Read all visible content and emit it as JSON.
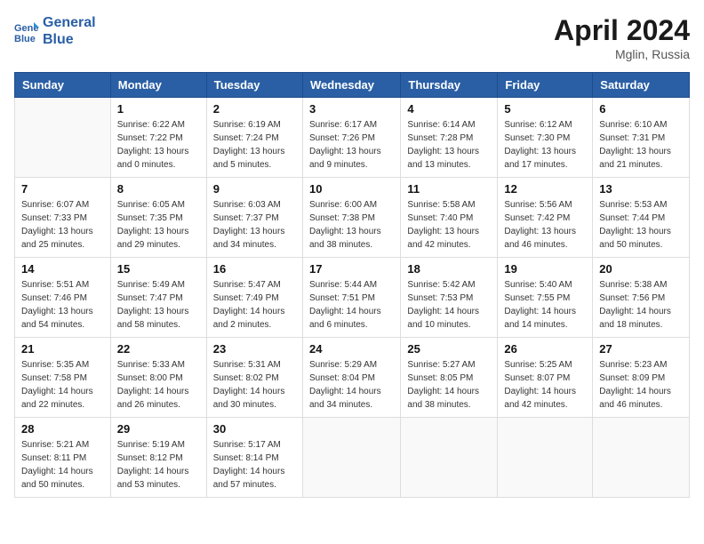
{
  "header": {
    "logo_line1": "General",
    "logo_line2": "Blue",
    "month": "April 2024",
    "location": "Mglin, Russia"
  },
  "days_of_week": [
    "Sunday",
    "Monday",
    "Tuesday",
    "Wednesday",
    "Thursday",
    "Friday",
    "Saturday"
  ],
  "weeks": [
    [
      {
        "day": "",
        "info": ""
      },
      {
        "day": "1",
        "info": "Sunrise: 6:22 AM\nSunset: 7:22 PM\nDaylight: 13 hours\nand 0 minutes."
      },
      {
        "day": "2",
        "info": "Sunrise: 6:19 AM\nSunset: 7:24 PM\nDaylight: 13 hours\nand 5 minutes."
      },
      {
        "day": "3",
        "info": "Sunrise: 6:17 AM\nSunset: 7:26 PM\nDaylight: 13 hours\nand 9 minutes."
      },
      {
        "day": "4",
        "info": "Sunrise: 6:14 AM\nSunset: 7:28 PM\nDaylight: 13 hours\nand 13 minutes."
      },
      {
        "day": "5",
        "info": "Sunrise: 6:12 AM\nSunset: 7:30 PM\nDaylight: 13 hours\nand 17 minutes."
      },
      {
        "day": "6",
        "info": "Sunrise: 6:10 AM\nSunset: 7:31 PM\nDaylight: 13 hours\nand 21 minutes."
      }
    ],
    [
      {
        "day": "7",
        "info": "Sunrise: 6:07 AM\nSunset: 7:33 PM\nDaylight: 13 hours\nand 25 minutes."
      },
      {
        "day": "8",
        "info": "Sunrise: 6:05 AM\nSunset: 7:35 PM\nDaylight: 13 hours\nand 29 minutes."
      },
      {
        "day": "9",
        "info": "Sunrise: 6:03 AM\nSunset: 7:37 PM\nDaylight: 13 hours\nand 34 minutes."
      },
      {
        "day": "10",
        "info": "Sunrise: 6:00 AM\nSunset: 7:38 PM\nDaylight: 13 hours\nand 38 minutes."
      },
      {
        "day": "11",
        "info": "Sunrise: 5:58 AM\nSunset: 7:40 PM\nDaylight: 13 hours\nand 42 minutes."
      },
      {
        "day": "12",
        "info": "Sunrise: 5:56 AM\nSunset: 7:42 PM\nDaylight: 13 hours\nand 46 minutes."
      },
      {
        "day": "13",
        "info": "Sunrise: 5:53 AM\nSunset: 7:44 PM\nDaylight: 13 hours\nand 50 minutes."
      }
    ],
    [
      {
        "day": "14",
        "info": "Sunrise: 5:51 AM\nSunset: 7:46 PM\nDaylight: 13 hours\nand 54 minutes."
      },
      {
        "day": "15",
        "info": "Sunrise: 5:49 AM\nSunset: 7:47 PM\nDaylight: 13 hours\nand 58 minutes."
      },
      {
        "day": "16",
        "info": "Sunrise: 5:47 AM\nSunset: 7:49 PM\nDaylight: 14 hours\nand 2 minutes."
      },
      {
        "day": "17",
        "info": "Sunrise: 5:44 AM\nSunset: 7:51 PM\nDaylight: 14 hours\nand 6 minutes."
      },
      {
        "day": "18",
        "info": "Sunrise: 5:42 AM\nSunset: 7:53 PM\nDaylight: 14 hours\nand 10 minutes."
      },
      {
        "day": "19",
        "info": "Sunrise: 5:40 AM\nSunset: 7:55 PM\nDaylight: 14 hours\nand 14 minutes."
      },
      {
        "day": "20",
        "info": "Sunrise: 5:38 AM\nSunset: 7:56 PM\nDaylight: 14 hours\nand 18 minutes."
      }
    ],
    [
      {
        "day": "21",
        "info": "Sunrise: 5:35 AM\nSunset: 7:58 PM\nDaylight: 14 hours\nand 22 minutes."
      },
      {
        "day": "22",
        "info": "Sunrise: 5:33 AM\nSunset: 8:00 PM\nDaylight: 14 hours\nand 26 minutes."
      },
      {
        "day": "23",
        "info": "Sunrise: 5:31 AM\nSunset: 8:02 PM\nDaylight: 14 hours\nand 30 minutes."
      },
      {
        "day": "24",
        "info": "Sunrise: 5:29 AM\nSunset: 8:04 PM\nDaylight: 14 hours\nand 34 minutes."
      },
      {
        "day": "25",
        "info": "Sunrise: 5:27 AM\nSunset: 8:05 PM\nDaylight: 14 hours\nand 38 minutes."
      },
      {
        "day": "26",
        "info": "Sunrise: 5:25 AM\nSunset: 8:07 PM\nDaylight: 14 hours\nand 42 minutes."
      },
      {
        "day": "27",
        "info": "Sunrise: 5:23 AM\nSunset: 8:09 PM\nDaylight: 14 hours\nand 46 minutes."
      }
    ],
    [
      {
        "day": "28",
        "info": "Sunrise: 5:21 AM\nSunset: 8:11 PM\nDaylight: 14 hours\nand 50 minutes."
      },
      {
        "day": "29",
        "info": "Sunrise: 5:19 AM\nSunset: 8:12 PM\nDaylight: 14 hours\nand 53 minutes."
      },
      {
        "day": "30",
        "info": "Sunrise: 5:17 AM\nSunset: 8:14 PM\nDaylight: 14 hours\nand 57 minutes."
      },
      {
        "day": "",
        "info": ""
      },
      {
        "day": "",
        "info": ""
      },
      {
        "day": "",
        "info": ""
      },
      {
        "day": "",
        "info": ""
      }
    ]
  ]
}
